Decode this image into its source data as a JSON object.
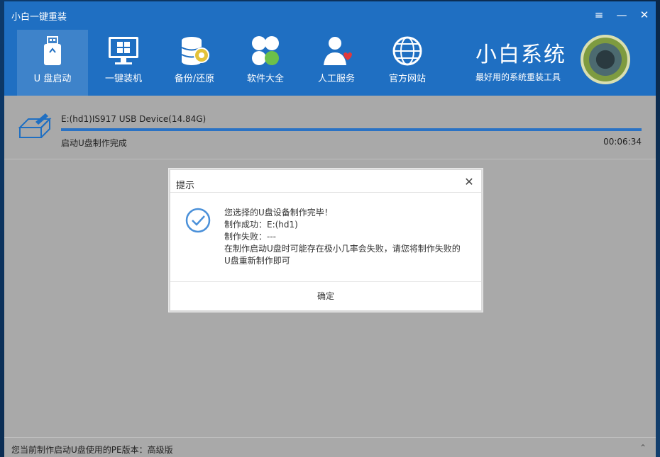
{
  "window": {
    "title": "小白一键重装",
    "menu_icon": "≡",
    "min_icon": "—",
    "close_icon": "✕"
  },
  "nav": [
    {
      "label": "U 盘启动",
      "icon": "usb-drive-icon",
      "active": true
    },
    {
      "label": "一键装机",
      "icon": "monitor-windows-icon",
      "active": false
    },
    {
      "label": "备份/还原",
      "icon": "database-backup-icon",
      "active": false
    },
    {
      "label": "软件大全",
      "icon": "clover-apps-icon",
      "active": false
    },
    {
      "label": "人工服务",
      "icon": "person-heart-icon",
      "active": false
    },
    {
      "label": "官方网站",
      "icon": "globe-icon",
      "active": false
    }
  ],
  "brand": {
    "name": "小白系统",
    "slogan": "最好用的系统重装工具"
  },
  "device": {
    "name": "E:(hd1)IS917 USB Device(14.84G)",
    "status": "启动U盘制作完成",
    "elapsed": "00:06:34",
    "progress": 1.0
  },
  "dialog": {
    "title": "提示",
    "close_icon": "✕",
    "lines": [
      "您选择的U盘设备制作完毕！",
      "制作成功：E:(hd1)",
      "制作失败：---",
      "在制作启动U盘时可能存在极小几率会失败，请您将制作失败的",
      "U盘重新制作即可"
    ],
    "ok_label": "确定"
  },
  "footer": {
    "text": "您当前制作启动U盘使用的PE版本：高级版",
    "scroll_icon": "⌃"
  },
  "colors": {
    "header": "#1f6fc2",
    "body": "#a9a9a9",
    "progress": "#2a72c4",
    "check": "#4a90d9"
  }
}
